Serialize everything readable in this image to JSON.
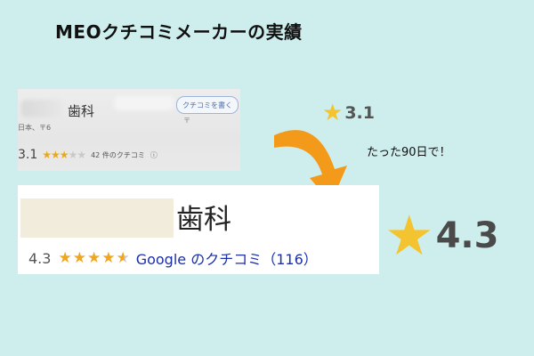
{
  "title": "MEOクチコミメーカーの実績",
  "before": {
    "clinic_name": "歯科",
    "write_review_button": "クチコミを書く",
    "address_fragment": "日本、〒6",
    "side_fragment": "〒",
    "rating": "3.1",
    "stars_filled": 3,
    "stars_total": 5,
    "review_count_text": "42 件のクチコミ",
    "info_icon": "ⓘ"
  },
  "small_rating": {
    "value": "3.1",
    "star_icon": "star-icon"
  },
  "caption": "たった90日で！",
  "after": {
    "clinic_name": "歯科",
    "rating": "4.3",
    "stars_level": 4.3,
    "stars_total": 5,
    "google_reviews_text": "Google のクチコミ（116）"
  },
  "big_rating": {
    "value": "4.3",
    "star_icon": "star-icon"
  },
  "colors": {
    "background": "#cdeeed",
    "arrow": "#f39a1a",
    "star": "#f4c430",
    "link": "#1a2fa8"
  }
}
